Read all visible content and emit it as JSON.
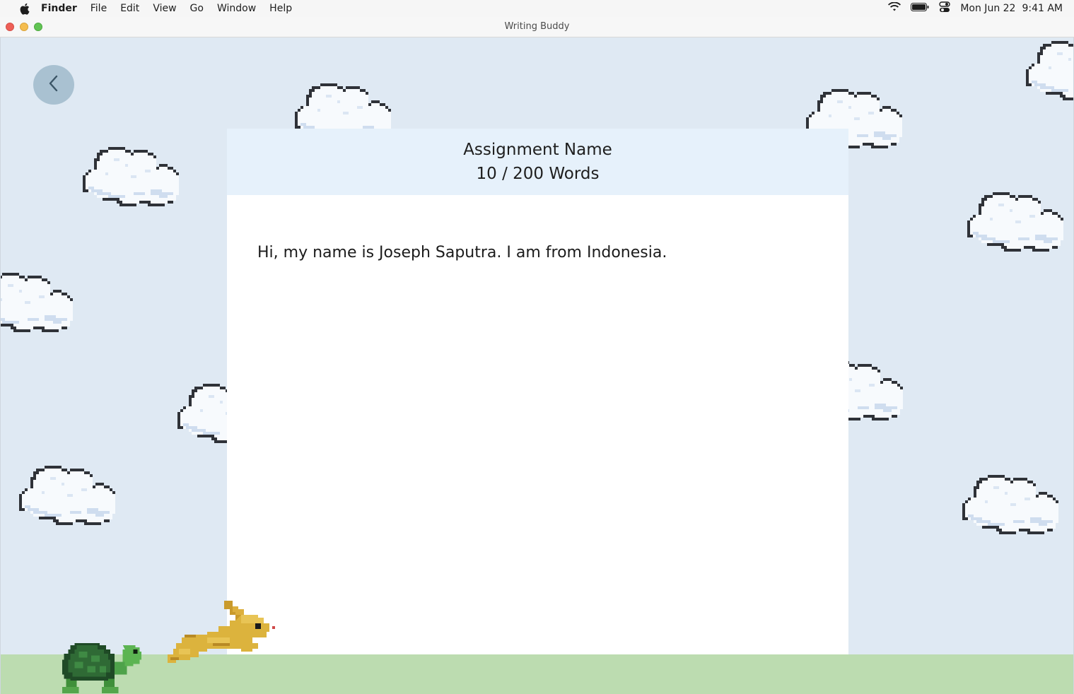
{
  "menubar": {
    "app_name": "Finder",
    "items": [
      "File",
      "Edit",
      "View",
      "Go",
      "Window",
      "Help"
    ],
    "date": "Mon Jun 22",
    "time": "9:41 AM"
  },
  "window": {
    "title": "Writing Buddy"
  },
  "assignment": {
    "name": "Assignment Name",
    "word_count": "10 / 200 Words",
    "body": "Hi, my name is Joseph Saputra. I am from Indonesia."
  },
  "colors": {
    "sky": "#dfe9f3",
    "ground": "#bcdcb0",
    "panel_header": "#e6f1fb",
    "back_button": "#a9c1d1"
  },
  "icons": {
    "back": "chevron-left-icon",
    "apple": "apple-logo-icon",
    "wifi": "wifi-icon",
    "battery": "battery-icon",
    "control_center": "control-center-icon"
  }
}
